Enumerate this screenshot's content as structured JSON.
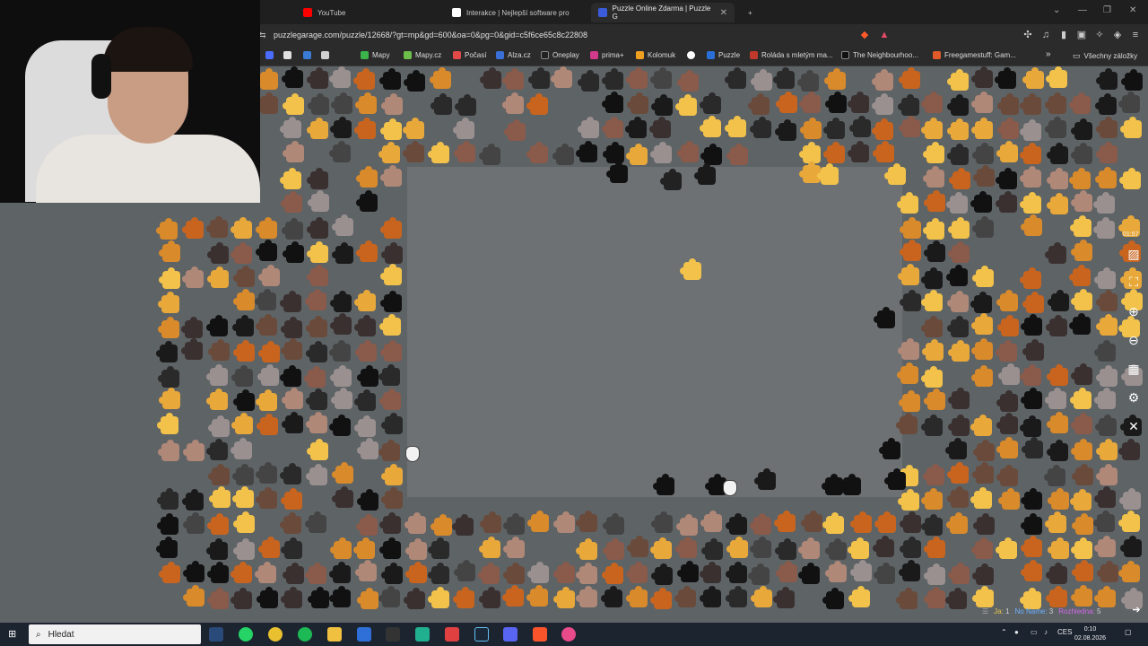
{
  "browser": {
    "tabs": [
      {
        "label": "YouTube",
        "color": "#ff0000"
      },
      {
        "label": "Interakce | Nejlepší software pro",
        "color": "#ffffff"
      },
      {
        "label": "Puzzle Online Zdarma | Puzzle G",
        "color": "#3b5bdb",
        "active": true
      }
    ],
    "new_tab": "+",
    "url": "puzzlegarage.com/puzzle/12668/?gt=mp&gd=600&oa=0&pg=0&gid=c5f6ce65c8c22808",
    "bookmarks": [
      {
        "label": "",
        "color": "#4a6cff"
      },
      {
        "label": "",
        "color": "#e0e0e0"
      },
      {
        "label": "",
        "color": "#3a7bd5"
      },
      {
        "label": "",
        "color": "#d0d0d0"
      },
      {
        "label": "Mapy",
        "color": "#3bb54a"
      },
      {
        "label": "Mapy.cz",
        "color": "#6cc04a"
      },
      {
        "label": "Počasí",
        "color": "#e24a4a"
      },
      {
        "label": "Alza.cz",
        "color": "#3a6fd8"
      },
      {
        "label": "Oneplay",
        "color": "#222222"
      },
      {
        "label": "prima+",
        "color": "#d23a8c"
      },
      {
        "label": "Kolomuk",
        "color": "#f0a020"
      },
      {
        "label": "",
        "color": "#ffffff"
      },
      {
        "label": "Puzzle",
        "color": "#2a6fd8"
      },
      {
        "label": "Roláda s mletým ma...",
        "color": "#c0392b"
      },
      {
        "label": "The Neighbourhoo...",
        "color": "#111111"
      },
      {
        "label": "Freegamestuff: Gam...",
        "color": "#e05a2a"
      }
    ],
    "bookmarks_more": "»",
    "all_bookmarks": "Všechny záložky"
  },
  "game": {
    "timer": "01:57",
    "status": [
      {
        "label": "Ja:",
        "value": "1",
        "color": "#e8c44a"
      },
      {
        "label": "No Name:",
        "value": "3",
        "color": "#6ab0ff"
      },
      {
        "label": "Rozhledna:",
        "value": "5",
        "color": "#d06ae8"
      }
    ],
    "tools": [
      "image-icon",
      "fullscreen-icon",
      "zoom-in-icon",
      "zoom-out-icon",
      "grid-icon",
      "settings-icon",
      "close-icon"
    ]
  },
  "taskbar": {
    "search_placeholder": "Hledat",
    "language": "CES",
    "time": "0:10",
    "date": "02.08.2026"
  }
}
